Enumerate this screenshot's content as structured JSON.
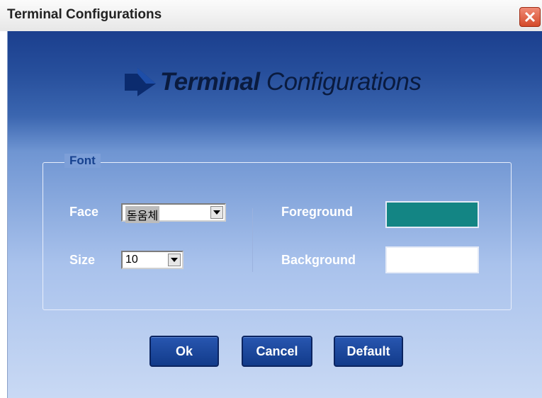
{
  "window": {
    "title": "Terminal Configurations"
  },
  "banner": {
    "bold": "Terminal",
    "rest": " Configurations"
  },
  "font_group": {
    "label": "Font",
    "face_label": "Face",
    "face_value": "돋움체",
    "size_label": "Size",
    "size_value": "10",
    "foreground_label": "Foreground",
    "background_label": "Background"
  },
  "colors": {
    "foreground": "#138584",
    "background": "#ffffff",
    "accent": "#1a4ba3"
  },
  "buttons": {
    "ok": "Ok",
    "cancel": "Cancel",
    "default": "Default"
  },
  "icons": {
    "close": "close-icon",
    "banner": "arrow-icon",
    "dropdown": "chevron-down-icon"
  }
}
